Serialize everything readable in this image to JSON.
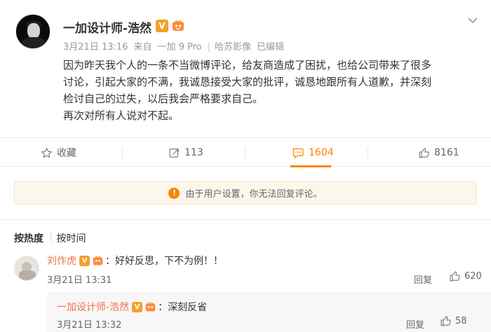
{
  "post": {
    "author_name": "一加设计师-浩然",
    "badge_v": "V",
    "meta": {
      "timestamp": "3月21日 13:16",
      "source_prefix": "来自",
      "device": "一加 9 Pro",
      "camera": "哈苏影像",
      "edited": "已编辑"
    },
    "text_lines": [
      "因为昨天我个人的一条不当微博评论，给友商造成了困扰，也给公司带来了很多",
      "讨论，引起大家的不满，我诚恳接受大家的批评，诚恳地跟所有人道歉，并深刻",
      "检讨自己的过失，以后我会严格要求自己。",
      "再次对所有人说对不起。"
    ]
  },
  "actions": {
    "favorite_label": "收藏",
    "repost_count": "113",
    "comment_count": "1604",
    "like_count": "8161"
  },
  "notice": {
    "icon": "!",
    "text": "由于用户设置，你无法回复评论。"
  },
  "sort_tabs": [
    "按热度",
    "按时间"
  ],
  "comments": [
    {
      "author": "刘作虎",
      "badge_v": "V",
      "text": "好好反思，下不为例！！",
      "time": "3月21日 13:31",
      "reply_label": "回复",
      "likes": "620",
      "replies": [
        {
          "author": "一加设计师-浩然",
          "badge_v": "V",
          "text": "深刻反省",
          "time": "3月21日 13:32",
          "reply_label": "回复",
          "likes": "58"
        }
      ]
    }
  ],
  "colors": {
    "accent": "#ff8200",
    "name_link": "#eb7350",
    "badge": "#f2a12a",
    "notice_bg": "#fdf6ec"
  },
  "icons": {
    "favorite": "star-icon",
    "repost": "repost-icon",
    "comment": "comment-icon",
    "like": "thumbs-up-icon",
    "menu": "chevron-down-icon",
    "notice": "warning-icon"
  }
}
